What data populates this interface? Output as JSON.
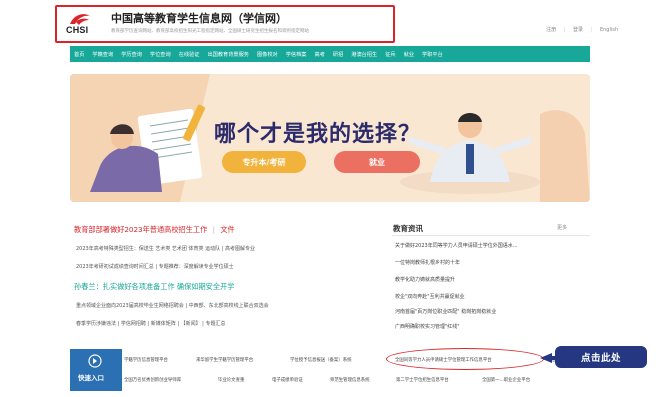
{
  "header": {
    "logo_text": "CHSI",
    "site_title": "中国高等教育学生信息网（学信网）",
    "site_sub": "教育部学历查询网站、教育部高校招生阳光工程指定网站、全国硕士研究生招生报名和调剂指定网站",
    "top_links": [
      "注册",
      "登录",
      "English"
    ]
  },
  "nav": [
    "首页",
    "学籍查询",
    "学历查询",
    "学位查询",
    "在线验证",
    "出国教育背景服务",
    "图像校对",
    "学信档案",
    "高考",
    "研招",
    "港澳台招生",
    "征兵",
    "就业",
    "学职平台"
  ],
  "banner": {
    "title": "哪个才是我的选择？",
    "btn1": "专升本/考研",
    "btn2": "就业"
  },
  "left": {
    "headline1": "教育部部署做好2023年普通高校招生工作",
    "headline1_sep": "|",
    "headline1_extra": "文件",
    "line2": "2023年高考特殊类型招生：保送生  艺术类  艺术团  体育类  运动队  |  高考图解专业",
    "line3": "2023年考研初试成绩查询时间汇总  |  专题推荐：深度解读专业学位硕士",
    "headline2": "孙春兰：扎实做好各项准备工作 确保如期安全开学",
    "line5": "重点领域企业面向2023届高校毕业生网络招聘会  |  中西部、东北部高校线上联合双选会",
    "line6": "春季学历涉嫌违法  |  学信网招聘  |  新媒体矩阵  |  【新闻】  |  专题汇总"
  },
  "right": {
    "title": "教育资讯",
    "more": "更多",
    "items": [
      "关于做好2023年同等学力人员申请硕士学位外国语水...",
      "一位特岗教师扎根乡村的十年",
      "教学化助力铸就高质量提升",
      "校企\"双向奔赴\"互利共赢促就业",
      "河南首届\"百万岗位职业匹配\" 稳岗拓岗稳就业",
      "广西明确职校实习管理\"红线\""
    ]
  },
  "bottom": {
    "entry": "快速入口",
    "row1": [
      "学籍学历信息管理平台",
      "来华留学生学籍学历管理平台",
      "学位授予信息报送（备案）系统",
      "全国同等学力人员申请硕士学位管理工作信息平台",
      "全国"
    ],
    "row2": [
      "全国万名优秀创新创业导师库",
      "毕业论文查重",
      "电子成绩单验证",
      "师范生管理信息系统",
      "第二学士学位招生信息平台",
      "全国第一...职业企业平台"
    ],
    "click_label": "点击此处"
  }
}
